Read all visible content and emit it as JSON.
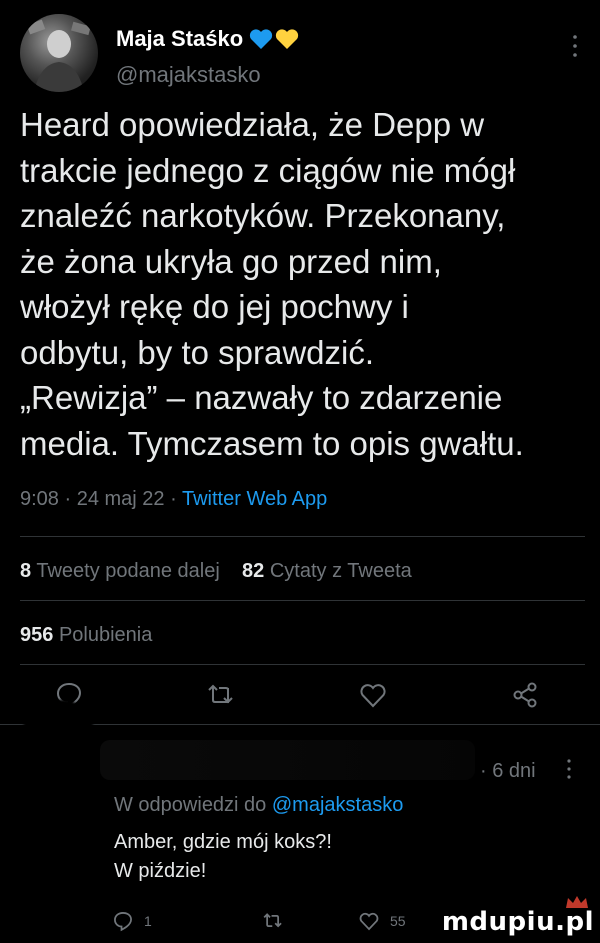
{
  "tweet": {
    "author_name": "Maja Staśko",
    "author_handle": "@majakstasko",
    "text": "Heard opowiedziała, że Depp w\ntrakcie jednego z ciągów nie mógł\nznaleźć narkotyków. Przekonany,\nże żona ukryła go przed nim,\nwłożył rękę do jej pochwy i\nodbytu, by to sprawdzić.\n„Rewizja” – nazwały to zdarzenie\nmedia. Tymczasem to opis gwałtu.",
    "time": "9:08",
    "date": "24 maj 22",
    "source": "Twitter Web App",
    "retweets_count": "8",
    "retweets_label": "Tweety podane dalej",
    "quotes_count": "82",
    "quotes_label": "Cytaty z Tweeta",
    "likes_count": "956",
    "likes_label": "Polubienia",
    "emoji_colors": {
      "blue_heart": "#1d9bf0",
      "yellow_heart": "#ffd23f"
    }
  },
  "reply": {
    "time": "6 dni",
    "reply_prefix": "W odpowiedzi do",
    "reply_mention": "@majakstasko",
    "text": "Amber, gdzie mój koks?!\nW piździe!",
    "reply_count": "1",
    "like_count": "55"
  },
  "watermark": "mdupiu.pl",
  "colors": {
    "background": "#000000",
    "text": "#e7e9ea",
    "muted": "#71767b",
    "accent": "#1d9bf0"
  }
}
